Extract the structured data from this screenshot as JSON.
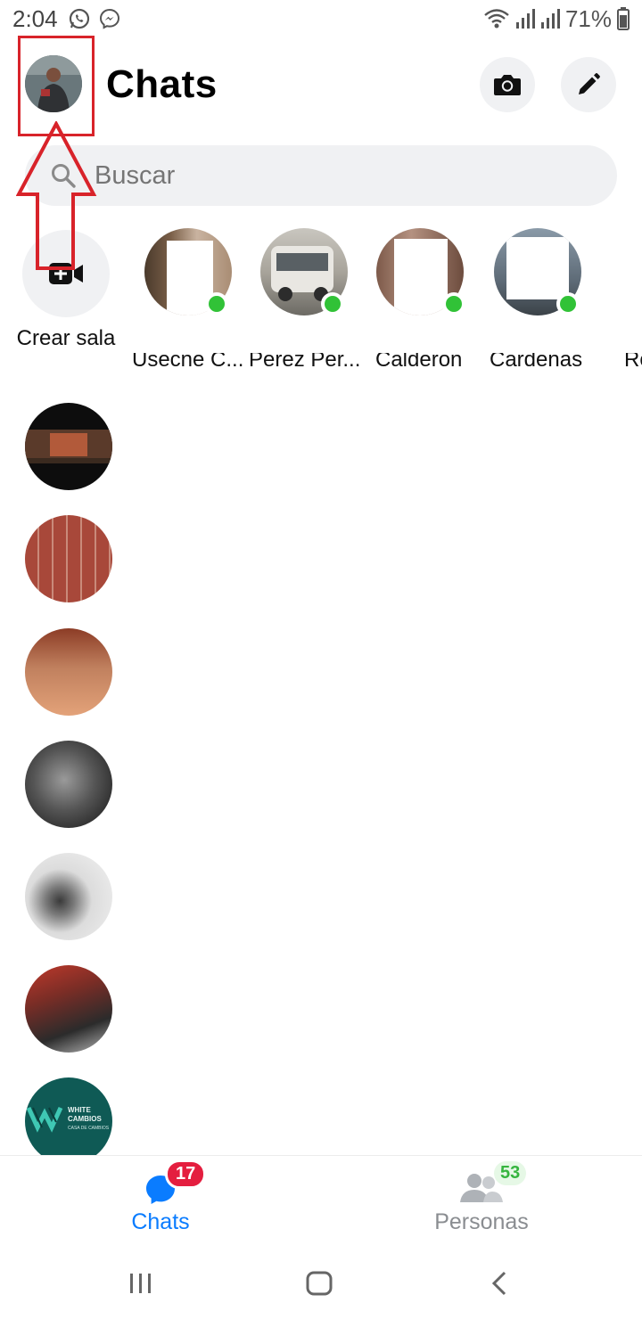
{
  "status_bar": {
    "time": "2:04",
    "battery": "71%",
    "icons": [
      "whatsapp-icon",
      "messenger-icon",
      "wifi-icon",
      "signal-icon",
      "signal-icon",
      "battery-icon"
    ]
  },
  "header": {
    "title": "Chats",
    "camera_icon": "camera-icon",
    "compose_icon": "pencil-icon"
  },
  "search": {
    "placeholder": "Buscar"
  },
  "stories": {
    "create_room_label": "Crear sala",
    "people": [
      {
        "name": "Usecne C...",
        "online": true
      },
      {
        "name": "Perez Per...",
        "online": true
      },
      {
        "name": "Calderon",
        "online": true
      },
      {
        "name": "Cardenas",
        "online": true
      },
      {
        "name": "Ro",
        "online": false
      }
    ]
  },
  "chat_list": {
    "count": 7,
    "white_cambios_logo_text": "WHITE CAMBIOS CASA DE CAMBIOS"
  },
  "bottom_nav": {
    "tabs": [
      {
        "label": "Chats",
        "badge": "17",
        "active": true,
        "icon": "chat-bubble-icon"
      },
      {
        "label": "Personas",
        "badge": "53",
        "active": false,
        "icon": "people-icon"
      }
    ]
  },
  "colors": {
    "accent": "#0a7cff",
    "badge_red": "#e41e3f",
    "online_green": "#31c237",
    "annotation_red": "#d8232a",
    "inactive_tab": "#8a8d91"
  }
}
